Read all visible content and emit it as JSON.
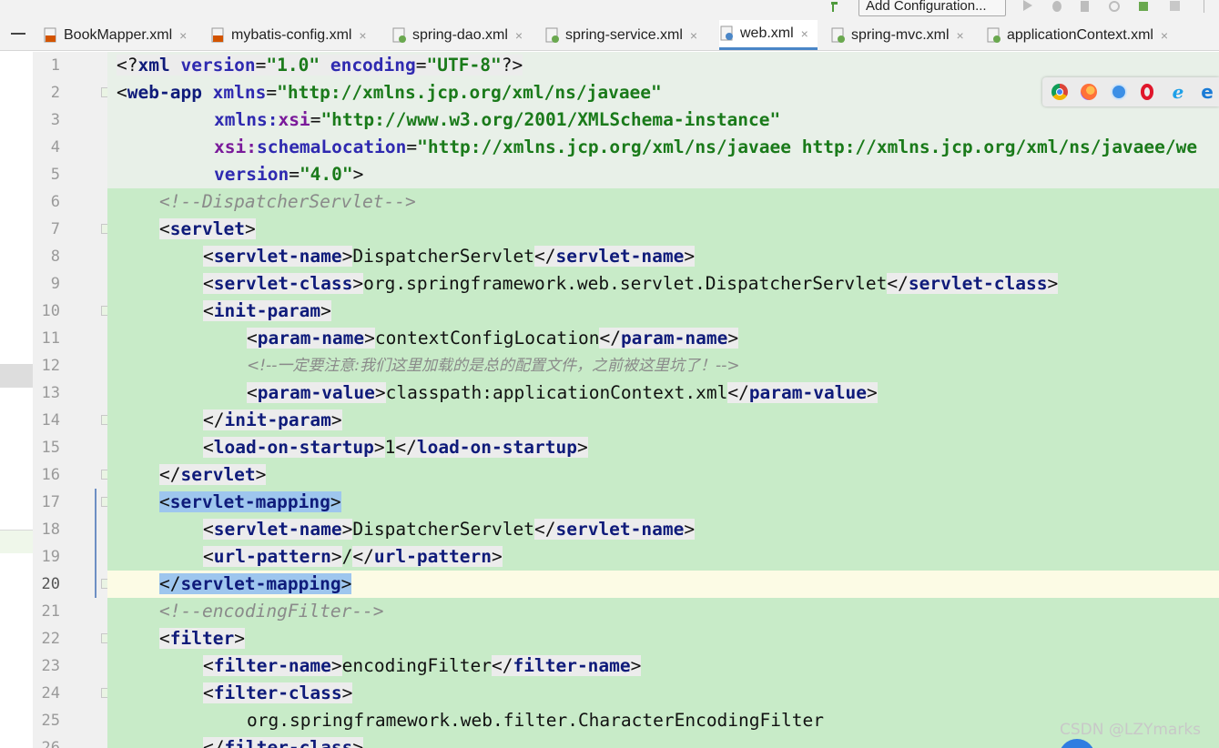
{
  "toolbar": {
    "add_configuration_label": "Add Configuration..."
  },
  "tabs": [
    {
      "label": "BookMapper.xml",
      "close": "×",
      "icon": "xml-file-icon",
      "color": "#d35400"
    },
    {
      "label": "mybatis-config.xml",
      "close": "×",
      "icon": "xml-file-icon",
      "color": "#d35400"
    },
    {
      "label": "spring-dao.xml",
      "close": "×",
      "icon": "spring-xml-file-icon",
      "color": "#6aa84f"
    },
    {
      "label": "spring-service.xml",
      "close": "×",
      "icon": "spring-xml-file-icon",
      "color": "#6aa84f"
    },
    {
      "label": "web.xml",
      "close": "×",
      "icon": "web-xml-file-icon",
      "color": "#4a86c7",
      "active": true
    },
    {
      "label": "spring-mvc.xml",
      "close": "×",
      "icon": "spring-xml-file-icon",
      "color": "#6aa84f"
    },
    {
      "label": "applicationContext.xml",
      "close": "×",
      "icon": "spring-xml-file-icon",
      "color": "#6aa84f"
    }
  ],
  "lines": {
    "l1": {
      "p1": "<?",
      "p2": "xml",
      "p3": " version",
      "p4": "=",
      "p5": "\"1.0\"",
      "p6": " encoding",
      "p7": "=",
      "p8": "\"UTF-8\"",
      "p9": "?>"
    },
    "l2": {
      "p1": "<",
      "p2": "web-app",
      "p3": " xmlns",
      "p4": "=",
      "p5": "\"http://xmlns.jcp.org/xml/ns/javaee\""
    },
    "l3": {
      "p1": "xmlns:",
      "p2": "xsi",
      "p3": "=",
      "p4": "\"http://www.w3.org/2001/XMLSchema-instance\""
    },
    "l4": {
      "p1": "xsi:",
      "p2": "schemaLocation",
      "p3": "=",
      "p4": "\"http://xmlns.jcp.org/xml/ns/javaee http://xmlns.jcp.org/xml/ns/javaee/we"
    },
    "l5": {
      "p1": "version",
      "p2": "=",
      "p3": "\"4.0\"",
      "p4": ">"
    },
    "l6": "<!--DispatcherServlet-->",
    "l7": {
      "o": "<",
      "t": "servlet",
      "c": ">"
    },
    "l8": {
      "t": "servlet-name",
      "v": "DispatcherServlet"
    },
    "l9": {
      "t": "servlet-class",
      "v": "org.springframework.web.servlet.DispatcherServlet"
    },
    "l10": {
      "o": "<",
      "t": "init-param",
      "c": ">"
    },
    "l11": {
      "t": "param-name",
      "v": "contextConfigLocation"
    },
    "l12": "<!--一定要注意:我们这里加载的是总的配置文件，之前被这里坑了！-->",
    "l13": {
      "t": "param-value",
      "v": "classpath:applicationContext.xml"
    },
    "l14": {
      "o": "</",
      "t": "init-param",
      "c": ">"
    },
    "l15": {
      "t": "load-on-startup",
      "v": "1"
    },
    "l16": {
      "o": "</",
      "t": "servlet",
      "c": ">"
    },
    "l17": {
      "o": "<",
      "t": "servlet-mapping",
      "c": ">"
    },
    "l18": {
      "t": "servlet-name",
      "v": "DispatcherServlet"
    },
    "l19": {
      "t": "url-pattern",
      "v": "/"
    },
    "l20": {
      "o": "</",
      "t": "servlet-mapping",
      "c": ">"
    },
    "l21": "<!--encodingFilter-->",
    "l22": {
      "o": "<",
      "t": "filter",
      "c": ">"
    },
    "l23": {
      "t": "filter-name",
      "v": "encodingFilter"
    },
    "l24": {
      "o": "<",
      "t": "filter-class",
      "c": ">"
    },
    "l25": "org.springframework.web.filter.CharacterEncodingFilter",
    "l26": {
      "o": "</",
      "t": "filter-class",
      "c": ">"
    }
  },
  "line_numbers": [
    "1",
    "2",
    "3",
    "4",
    "5",
    "6",
    "7",
    "8",
    "9",
    "10",
    "11",
    "12",
    "13",
    "14",
    "15",
    "16",
    "17",
    "18",
    "19",
    "20",
    "21",
    "22",
    "23",
    "24",
    "25",
    "26"
  ],
  "browser_icons": [
    {
      "name": "chrome-icon",
      "color": "#db4437"
    },
    {
      "name": "firefox-icon",
      "color": "#ff7139"
    },
    {
      "name": "safari-icon",
      "color": "#3c8fe6"
    },
    {
      "name": "opera-icon",
      "color": "#e0162b"
    },
    {
      "name": "ie-icon",
      "color": "#1ea0e8"
    },
    {
      "name": "edge-icon",
      "color": "#1a7bd6"
    }
  ],
  "watermark": "CSDN @LZYmarks"
}
